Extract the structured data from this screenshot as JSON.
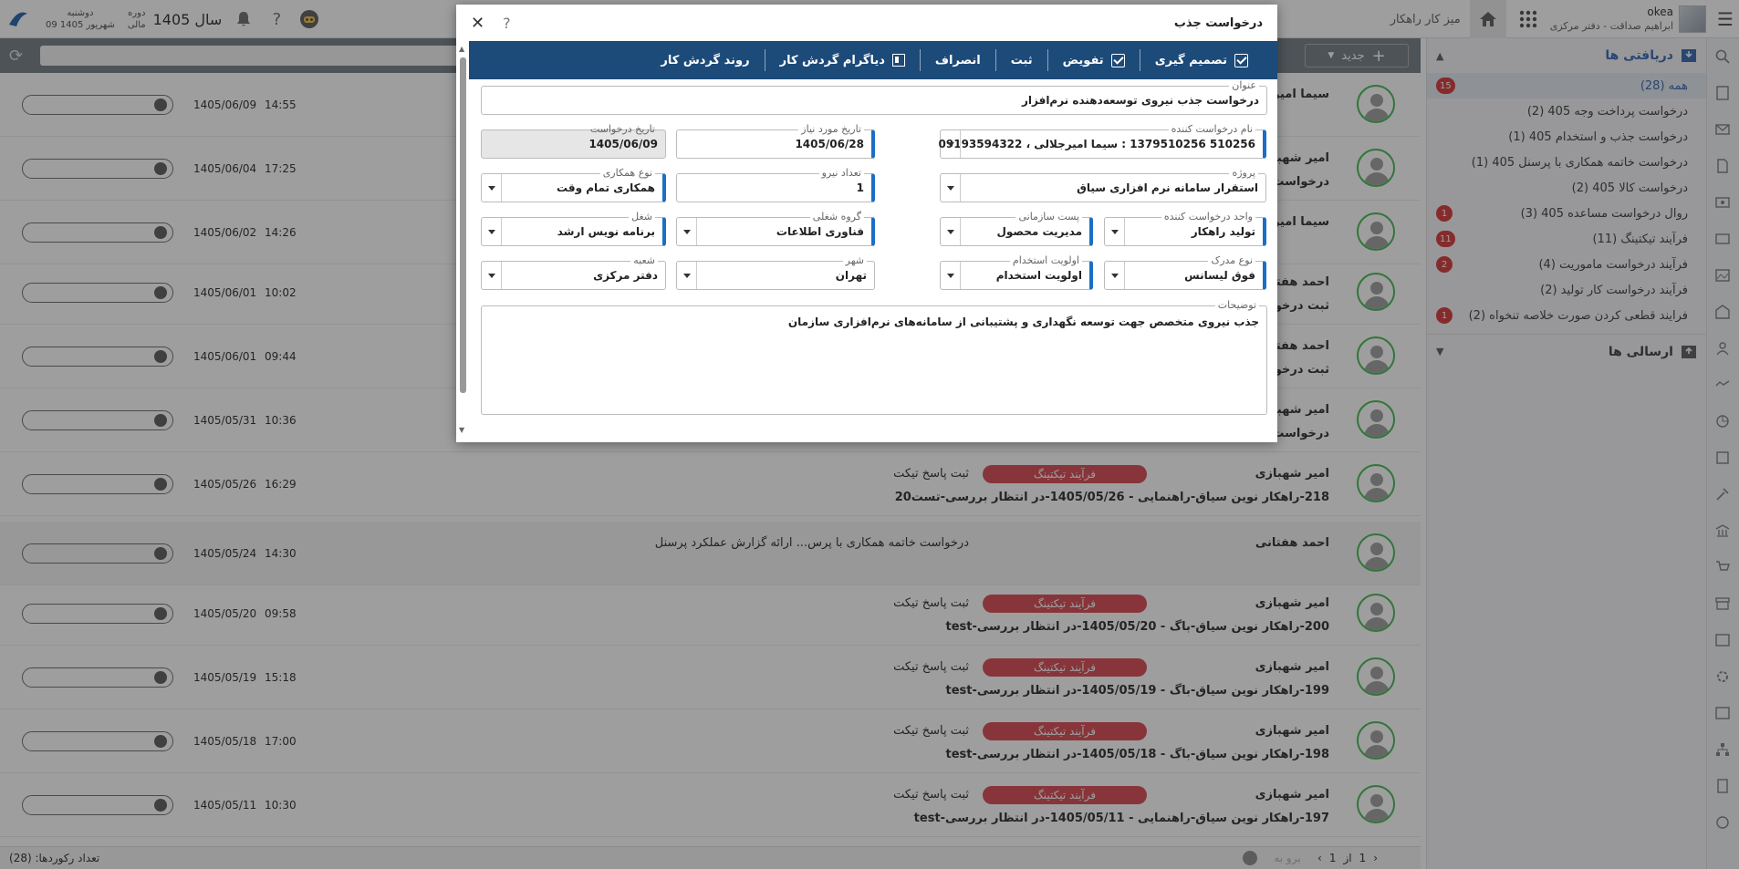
{
  "header": {
    "user_name": "okea",
    "user_role": "ابراهیم صداقت - دفتر مرکزی",
    "desk_label": "میز کار راهکار",
    "day": "دوشنبه",
    "date": "09 شهریور 1405",
    "period_label": "دوره",
    "period_sub": "مالی",
    "year": "سال 1405"
  },
  "sidebar": {
    "inbox_label": "دریافتی ها",
    "outbox_label": "ارسالی ها",
    "items": [
      {
        "label": "همه (28)",
        "badge": "15",
        "active": true
      },
      {
        "label": "درخواست پرداخت وجه 405 (2)",
        "badge": ""
      },
      {
        "label": "درخواست جذب و استخدام 405 (1)",
        "badge": ""
      },
      {
        "label": "درخواست خاتمه همکاری با پرسنل 405 (1)",
        "badge": ""
      },
      {
        "label": "درخواست کالا 405 (2)",
        "badge": ""
      },
      {
        "label": "روال درخواست مساعده 405 (3)",
        "badge": "1"
      },
      {
        "label": "فرآیند تیکتینگ (11)",
        "badge": "11"
      },
      {
        "label": "فرآیند درخواست ماموریت (4)",
        "badge": "2"
      },
      {
        "label": "فرآیند درخواست کار تولید (2)",
        "badge": ""
      },
      {
        "label": "فرایند قطعی کردن صورت خلاصه تنخواه (2)",
        "badge": "1"
      }
    ]
  },
  "list_toolbar": {
    "new_label": "جدید"
  },
  "rows": [
    {
      "sender": "سیما امیرجلا...",
      "subject": "",
      "tag": "",
      "action": "",
      "date": "1405/06/09",
      "time": "14:55"
    },
    {
      "sender": "امیر شهبازی",
      "subject": "درخواست م...",
      "tag": "",
      "action": "",
      "date": "1405/06/04",
      "time": "17:25"
    },
    {
      "sender": "سیما امیرجلا...",
      "subject": "",
      "tag": "",
      "action": "",
      "date": "1405/06/02",
      "time": "14:26"
    },
    {
      "sender": "احمد هفتانی",
      "subject": "ثبت درخوا...",
      "tag": "",
      "action": "",
      "date": "1405/06/01",
      "time": "10:02"
    },
    {
      "sender": "احمد هفتانی",
      "subject": "ثبت درخوا...",
      "tag": "",
      "action": "",
      "date": "1405/06/01",
      "time": "09:44"
    },
    {
      "sender": "امیر شهبازی",
      "subject": "درخواست م...",
      "tag": "",
      "action": "",
      "date": "1405/05/31",
      "time": "10:36"
    },
    {
      "sender": "امیر شهبازی",
      "subject": "218-راهکار نوین سیاق-راهنمایی - 1405/05/26-در انتظار بررسی-تست20",
      "tag": "فرآیند تیکتینگ",
      "action": "ثبت پاسخ تیکت",
      "date": "1405/05/26",
      "time": "16:29"
    },
    {
      "sender": "احمد هفتانی",
      "subject": "",
      "tag": "",
      "action": "درخواست خاتمه همکاری با پرس...     ارائه گزارش عملکرد پرسنل",
      "date": "1405/05/24",
      "time": "14:30"
    },
    {
      "sender": "امیر شهبازی",
      "subject": "200-راهکار نوین سیاق-باگ - 1405/05/20-در انتظار بررسی-test",
      "tag": "فرآیند تیکتینگ",
      "action": "ثبت پاسخ تیکت",
      "date": "1405/05/20",
      "time": "09:58"
    },
    {
      "sender": "امیر شهبازی",
      "subject": "199-راهکار نوین سیاق-باگ - 1405/05/19-در انتظار بررسی-test",
      "tag": "فرآیند تیکتینگ",
      "action": "ثبت پاسخ تیکت",
      "date": "1405/05/19",
      "time": "15:18"
    },
    {
      "sender": "امیر شهبازی",
      "subject": "198-راهکار نوین سیاق-باگ - 1405/05/18-در انتظار بررسی-test",
      "tag": "فرآیند تیکتینگ",
      "action": "ثبت پاسخ تیکت",
      "date": "1405/05/18",
      "time": "17:00"
    },
    {
      "sender": "امیر شهبازی",
      "subject": "197-راهکار نوین سیاق-راهنمایی - 1405/05/11-در انتظار بررسی-test",
      "tag": "فرآیند تیکتینگ",
      "action": "ثبت پاسخ تیکت",
      "date": "1405/05/11",
      "time": "10:30"
    }
  ],
  "footer": {
    "count": "تعداد رکوردها: (28)",
    "page": "1",
    "of": "از",
    "total": "1",
    "goto_placeholder": "برو به"
  },
  "modal": {
    "title": "درخواست جذب",
    "toolbar": [
      "تصمیم گیری",
      "تفویض",
      "ثبت",
      "انصراف",
      "دیاگرام گردش کار",
      "روند گردش کار"
    ],
    "fields": {
      "subject_label": "عنوان",
      "subject_value": "درخواست جذب نیروی توسعه‌دهنده نرم‌افزار",
      "requester_label": "نام درخواست کننده",
      "requester_value": "510256 1379510256 : سیما امیرجلالی ، 09193594322",
      "need_date_label": "تاریخ مورد نیاز",
      "need_date_value": "1405/06/28",
      "req_date_label": "تاریخ درخواست",
      "req_date_value": "1405/06/09",
      "project_label": "پروژه",
      "project_value": "استقرار سامانه نرم افزاری سیاق",
      "count_label": "تعداد نیرو",
      "count_value": "1",
      "coop_label": "نوع همکاری",
      "coop_value": "همکاری تمام وقت",
      "unit_label": "واحد درخواست کننده",
      "unit_value": "تولید راهکار",
      "post_label": "پست سازمانی",
      "post_value": "مدیریت محصول",
      "jobgroup_label": "گروه شغلی",
      "jobgroup_value": "فناوری اطلاعات",
      "job_label": "شغل",
      "job_value": "برنامه نویس ارشد",
      "degree_label": "نوع مدرک",
      "degree_value": "فوق لیسانس",
      "priority_label": "اولویت استخدام",
      "priority_value": "اولویت استخدام",
      "city_label": "شهر",
      "city_value": "تهران",
      "branch_label": "شعبه",
      "branch_value": "دفتر مرکزی",
      "desc_label": "توضیحات",
      "desc_value": "جذب نیروی متخصص جهت توسعه نگهداری و پشتیبانی از سامانه‌های نرم‌افزاری سازمان"
    }
  }
}
